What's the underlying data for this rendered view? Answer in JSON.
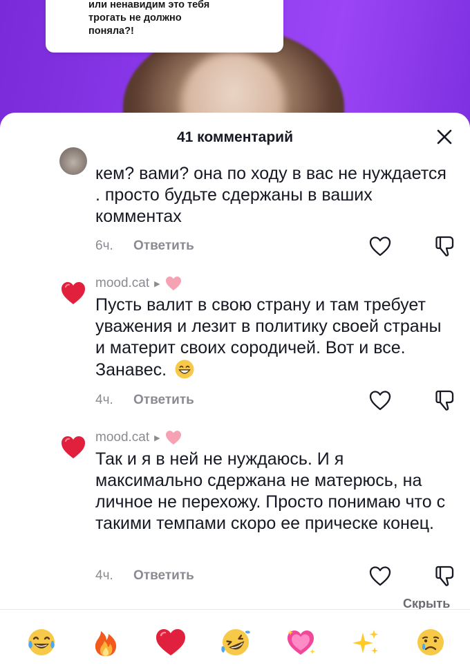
{
  "video": {
    "caption_lines": [
      "или ненавидим это тебя",
      "трогать не должно",
      "поняла?!"
    ]
  },
  "comments_sheet": {
    "title": "41 комментарий",
    "close_icon": "close-icon",
    "reply_label": "Ответить",
    "hide_label": "Скрыть",
    "comments": [
      {
        "username": "",
        "text": "кем? вами? она по ходу в вас не нуждается . просто будьте сдержаны в ваших комментах",
        "time": "6ч."
      },
      {
        "username": "mood.cat",
        "avatar_icon": "red-heart-icon",
        "badge_icon": "pink-heart-icon",
        "text": "Пусть валит в свою страну и там требует уважения и лезит в политику своей страны и материт своих сородичей. Вот и все. Занавес.",
        "emoji_icon": "grinning-face-icon",
        "time": "4ч."
      },
      {
        "username": "mood.cat",
        "avatar_icon": "red-heart-icon",
        "badge_icon": "pink-heart-icon",
        "text": "Так и я в ней не нуждаюсь. И я максимально сдержана не матерюсь, на личное не перехожу. Просто понимаю что с такими темпами скоро ее прическе конец.",
        "time": "4ч."
      }
    ]
  },
  "emoji_bar": {
    "emojis": [
      "tears-of-joy-icon",
      "fire-icon",
      "red-heart-icon",
      "rolling-laughing-icon",
      "sparkling-heart-icon",
      "sparkles-icon",
      "crying-face-icon"
    ]
  },
  "colors": {
    "video_background": "#8f3cf0",
    "text_primary": "#161823",
    "text_secondary": "#8a8b91",
    "heart_red": "#e0203c"
  }
}
